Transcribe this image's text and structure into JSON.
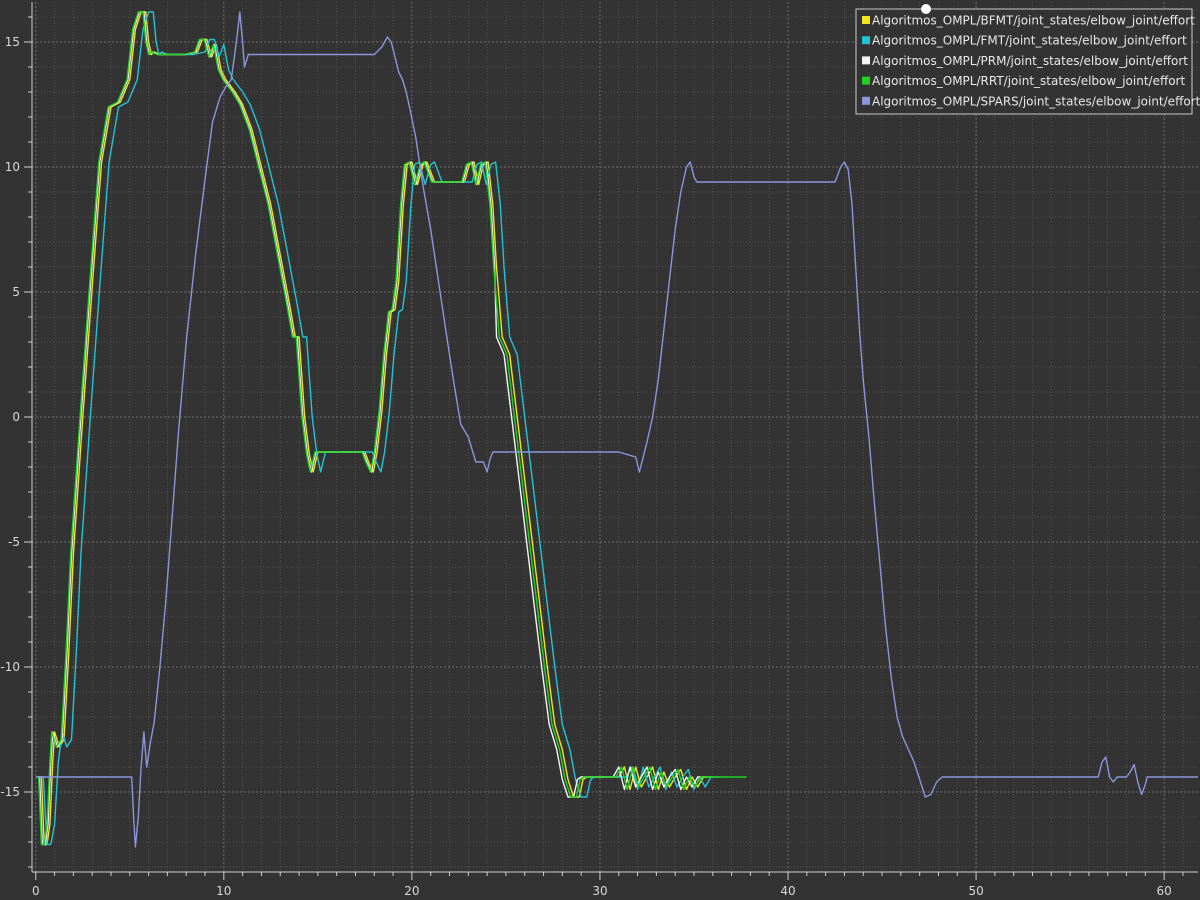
{
  "chart_data": {
    "type": "line",
    "title": "",
    "xlabel": "",
    "ylabel": "",
    "xlim": [
      -0.2,
      61.8
    ],
    "ylim": [
      -18.2,
      16.6
    ],
    "x_ticks": [
      0,
      10,
      20,
      30,
      40,
      50,
      60
    ],
    "x_tick_labels": [
      "0",
      "10",
      "20",
      "30",
      "40",
      "50",
      "60"
    ],
    "y_ticks": [
      -15,
      -10,
      -5,
      0,
      5,
      10,
      15
    ],
    "y_tick_labels": [
      "-15",
      "-10",
      "-5",
      "0",
      "5",
      "10",
      "15"
    ],
    "grid": true,
    "legend_position": "top-right",
    "background": "#333333",
    "series": [
      {
        "name": "Algoritmos_OMPL/BFMT/joint_states/elbow_joint/effort",
        "color": "#f2e41e",
        "x": [
          0.2,
          0.3,
          0.45,
          0.6,
          0.75,
          0.9,
          1.0,
          1.25,
          1.5,
          1.75,
          2.0,
          2.5,
          3.0,
          3.5,
          4.0,
          4.5,
          5.0,
          5.3,
          5.6,
          5.85,
          6.0,
          6.15,
          6.3,
          6.6,
          7.0,
          8.0,
          8.6,
          8.85,
          9.1,
          9.35,
          9.6,
          9.85,
          10.1,
          10.6,
          11.0,
          11.5,
          12.0,
          12.5,
          13.0,
          13.5,
          13.8,
          14.0,
          14.3,
          14.55,
          14.75,
          15.0,
          15.2,
          16.0,
          17.0,
          17.5,
          17.7,
          17.95,
          18.15,
          18.4,
          18.65,
          18.9,
          19.1,
          19.3,
          19.55,
          19.75,
          20.0,
          20.3,
          20.6,
          20.8,
          21.2,
          22.0,
          22.8,
          23.05,
          23.3,
          23.55,
          23.8,
          24.05,
          24.3,
          24.5,
          24.8,
          25.2,
          25.6,
          26.0,
          26.4,
          26.8,
          27.2,
          27.6,
          28.0,
          28.3,
          28.6,
          28.9,
          29.1,
          29.3,
          29.6,
          30.0,
          31.0,
          31.3,
          31.6,
          31.9,
          32.2,
          32.5,
          32.8,
          33.1,
          33.4,
          33.7,
          34.0,
          34.3,
          34.6,
          34.9,
          35.2,
          35.5,
          36.0
        ],
        "y": [
          -14.4,
          -14.4,
          -17.1,
          -17.1,
          -16.3,
          -13.8,
          -12.6,
          -13.2,
          -12.9,
          -9.5,
          -5.5,
          0.0,
          5.2,
          10.2,
          12.4,
          12.6,
          13.5,
          15.5,
          16.2,
          16.2,
          15.0,
          14.5,
          14.6,
          14.5,
          14.5,
          14.5,
          14.6,
          15.1,
          15.1,
          14.4,
          14.9,
          13.9,
          13.5,
          13.0,
          12.5,
          11.5,
          10.0,
          8.5,
          6.5,
          4.5,
          3.2,
          3.2,
          0.0,
          -1.5,
          -2.2,
          -1.4,
          -1.4,
          -1.4,
          -1.4,
          -1.4,
          -1.8,
          -2.2,
          -1.4,
          0.2,
          2.5,
          4.2,
          4.3,
          5.4,
          8.5,
          10.1,
          10.2,
          9.3,
          10.1,
          10.2,
          9.4,
          9.4,
          9.4,
          10.1,
          10.2,
          9.3,
          10.1,
          10.2,
          8.5,
          6.0,
          3.2,
          2.5,
          0.0,
          -2.5,
          -5.0,
          -7.5,
          -10.0,
          -12.3,
          -13.3,
          -14.5,
          -15.2,
          -15.2,
          -14.5,
          -14.4,
          -14.4,
          -14.4,
          -14.4,
          -14.0,
          -14.9,
          -14.0,
          -14.8,
          -14.4,
          -14.0,
          -14.9,
          -14.2,
          -14.8,
          -14.4,
          -14.1,
          -14.9,
          -14.4,
          -14.8,
          -14.4,
          -14.4
        ]
      },
      {
        "name": "Algoritmos_OMPL/FMT/joint_states/elbow_joint/effort",
        "color": "#22c4d4",
        "x": [
          0.25,
          0.4,
          0.6,
          0.8,
          1.0,
          1.2,
          1.4,
          1.65,
          1.9,
          2.15,
          2.4,
          2.9,
          3.4,
          3.9,
          4.4,
          4.9,
          5.4,
          5.7,
          6.0,
          6.25,
          6.4,
          6.55,
          6.7,
          7.0,
          7.4,
          8.4,
          9.0,
          9.25,
          9.5,
          9.75,
          10.0,
          10.25,
          10.5,
          11.0,
          11.4,
          11.9,
          12.4,
          12.9,
          13.4,
          13.9,
          14.2,
          14.4,
          14.7,
          14.95,
          15.15,
          15.4,
          15.6,
          16.4,
          17.4,
          17.9,
          18.1,
          18.35,
          18.55,
          18.8,
          19.05,
          19.3,
          19.5,
          19.7,
          19.95,
          20.15,
          20.4,
          20.7,
          21.0,
          21.2,
          21.6,
          22.4,
          23.2,
          23.45,
          23.7,
          23.95,
          24.2,
          24.45,
          24.7,
          24.9,
          25.2,
          25.6,
          26.0,
          26.4,
          26.8,
          27.2,
          27.6,
          28.0,
          28.4,
          28.7,
          29.0,
          29.3,
          29.5,
          29.7,
          30.0,
          30.4,
          31.4,
          31.7,
          32.0,
          32.3,
          32.6,
          32.9,
          33.2,
          33.5,
          33.8,
          34.1,
          34.4,
          34.7,
          35.0,
          35.3,
          35.6,
          35.9,
          36.4
        ],
        "y": [
          -14.4,
          -14.4,
          -17.1,
          -17.1,
          -16.3,
          -13.8,
          -12.6,
          -13.2,
          -12.9,
          -9.5,
          -5.5,
          0.0,
          5.2,
          10.2,
          12.4,
          12.6,
          13.5,
          15.5,
          16.2,
          16.2,
          15.0,
          14.5,
          14.6,
          14.5,
          14.5,
          14.5,
          14.6,
          15.1,
          15.1,
          14.4,
          14.9,
          13.9,
          13.5,
          13.0,
          12.5,
          11.5,
          10.0,
          8.5,
          6.5,
          4.5,
          3.2,
          3.2,
          0.0,
          -1.5,
          -2.2,
          -1.4,
          -1.4,
          -1.4,
          -1.4,
          -1.4,
          -1.8,
          -2.2,
          -1.4,
          0.2,
          2.5,
          4.2,
          4.3,
          5.4,
          8.5,
          10.1,
          10.2,
          9.3,
          10.1,
          10.2,
          9.4,
          9.4,
          9.4,
          10.1,
          10.2,
          9.3,
          10.1,
          10.2,
          8.5,
          6.0,
          3.2,
          2.5,
          0.0,
          -2.5,
          -5.0,
          -7.5,
          -10.0,
          -12.3,
          -13.3,
          -14.5,
          -15.2,
          -15.2,
          -14.5,
          -14.4,
          -14.4,
          -14.4,
          -14.4,
          -14.0,
          -14.9,
          -14.0,
          -14.8,
          -14.4,
          -14.0,
          -14.9,
          -14.2,
          -14.8,
          -14.4,
          -14.1,
          -14.9,
          -14.4,
          -14.8,
          -14.4,
          -14.4
        ]
      },
      {
        "name": "Algoritmos_OMPL/PRM/joint_states/elbow_joint/effort",
        "color": "#f4f4f4",
        "x": [
          0.1,
          0.2,
          0.35,
          0.5,
          0.65,
          0.8,
          0.9,
          1.15,
          1.4,
          1.65,
          1.9,
          2.4,
          2.9,
          3.4,
          3.9,
          4.4,
          4.9,
          5.2,
          5.5,
          5.75,
          5.9,
          6.05,
          6.2,
          6.5,
          6.9,
          7.9,
          8.5,
          8.75,
          9.0,
          9.25,
          9.5,
          9.75,
          10.0,
          10.5,
          10.9,
          11.4,
          11.9,
          12.4,
          12.9,
          13.4,
          13.7,
          13.9,
          14.2,
          14.45,
          14.65,
          14.9,
          15.1,
          15.9,
          16.9,
          17.4,
          17.6,
          17.85,
          18.05,
          18.3,
          18.55,
          18.8,
          19.0,
          19.2,
          19.45,
          19.65,
          19.9,
          20.2,
          20.5,
          20.7,
          21.1,
          21.9,
          22.7,
          22.95,
          23.2,
          23.45,
          23.7,
          23.95,
          24.2,
          24.4,
          24.5,
          24.9,
          25.3,
          25.7,
          26.1,
          26.5,
          26.9,
          27.3,
          27.7,
          28.0,
          28.3,
          28.6,
          28.8,
          29.0,
          29.3,
          29.7,
          30.7,
          31.0,
          31.3,
          31.6,
          31.9,
          32.2,
          32.5,
          32.8,
          33.1,
          33.4,
          33.7,
          34.0,
          34.3,
          34.6,
          34.9,
          35.2,
          35.7
        ],
        "y": [
          -14.4,
          -14.4,
          -17.1,
          -17.1,
          -16.3,
          -13.8,
          -12.6,
          -13.2,
          -12.9,
          -9.5,
          -5.5,
          0.0,
          5.2,
          10.2,
          12.4,
          12.6,
          13.5,
          15.5,
          16.2,
          16.2,
          15.0,
          14.5,
          14.6,
          14.5,
          14.5,
          14.5,
          14.6,
          15.1,
          15.1,
          14.4,
          14.9,
          13.9,
          13.5,
          13.0,
          12.5,
          11.5,
          10.0,
          8.5,
          6.5,
          4.5,
          3.2,
          3.2,
          0.0,
          -1.5,
          -2.2,
          -1.4,
          -1.4,
          -1.4,
          -1.4,
          -1.4,
          -1.8,
          -2.2,
          -1.4,
          0.2,
          2.5,
          4.2,
          4.3,
          5.4,
          8.5,
          10.1,
          10.2,
          9.3,
          10.1,
          10.2,
          9.4,
          9.4,
          9.4,
          10.1,
          10.2,
          9.3,
          10.1,
          10.2,
          8.5,
          6.0,
          3.2,
          2.5,
          0.0,
          -2.5,
          -5.0,
          -7.5,
          -10.0,
          -12.3,
          -13.3,
          -14.5,
          -15.2,
          -15.2,
          -14.5,
          -14.4,
          -14.4,
          -14.4,
          -14.4,
          -14.0,
          -14.9,
          -14.0,
          -14.8,
          -14.4,
          -14.0,
          -14.9,
          -14.2,
          -14.8,
          -14.4,
          -14.1,
          -14.9,
          -14.4,
          -14.8,
          -14.4,
          -14.4
        ]
      },
      {
        "name": "Algoritmos_OMPL/RRT/joint_states/elbow_joint/effort",
        "color": "#1ed21e",
        "x": [
          0.05,
          0.15,
          0.3,
          0.45,
          0.6,
          0.75,
          0.85,
          1.1,
          1.35,
          1.6,
          1.85,
          2.35,
          2.85,
          3.35,
          3.85,
          4.35,
          4.85,
          5.15,
          5.45,
          5.7,
          5.85,
          6.0,
          6.15,
          6.45,
          6.85,
          7.85,
          8.45,
          8.7,
          8.95,
          9.2,
          9.45,
          9.7,
          9.95,
          10.45,
          10.85,
          11.35,
          11.85,
          12.35,
          12.85,
          13.35,
          13.65,
          13.85,
          14.15,
          14.4,
          14.6,
          14.85,
          15.05,
          15.85,
          16.85,
          17.35,
          17.55,
          17.8,
          18.0,
          18.25,
          18.5,
          18.75,
          18.95,
          19.15,
          19.4,
          19.6,
          19.85,
          20.15,
          20.45,
          20.65,
          21.05,
          21.85,
          22.65,
          22.9,
          23.15,
          23.4,
          23.65,
          23.9,
          24.15,
          24.35,
          24.65,
          25.05,
          25.45,
          25.85,
          26.25,
          26.65,
          27.05,
          27.45,
          27.85,
          28.15,
          28.45,
          28.75,
          28.95,
          29.15,
          29.45,
          29.85,
          30.85,
          31.15,
          31.45,
          31.75,
          32.05,
          32.35,
          32.65,
          32.95,
          33.25,
          33.55,
          33.85,
          34.15,
          34.45,
          34.75,
          35.05,
          35.35,
          37.8
        ],
        "y": [
          -14.4,
          -14.4,
          -17.1,
          -17.1,
          -16.3,
          -13.8,
          -12.6,
          -13.2,
          -12.9,
          -9.5,
          -5.5,
          0.0,
          5.2,
          10.2,
          12.4,
          12.6,
          13.5,
          15.5,
          16.2,
          16.2,
          15.0,
          14.5,
          14.6,
          14.5,
          14.5,
          14.5,
          14.6,
          15.1,
          15.1,
          14.4,
          14.9,
          13.9,
          13.5,
          13.0,
          12.5,
          11.5,
          10.0,
          8.5,
          6.5,
          4.5,
          3.2,
          3.2,
          0.0,
          -1.5,
          -2.2,
          -1.4,
          -1.4,
          -1.4,
          -1.4,
          -1.4,
          -1.8,
          -2.2,
          -1.4,
          0.2,
          2.5,
          4.2,
          4.3,
          5.4,
          8.5,
          10.1,
          10.2,
          9.3,
          10.1,
          10.2,
          9.4,
          9.4,
          9.4,
          10.1,
          10.2,
          9.3,
          10.1,
          10.2,
          8.5,
          6.0,
          3.2,
          2.5,
          0.0,
          -2.5,
          -5.0,
          -7.5,
          -10.0,
          -12.3,
          -13.3,
          -14.5,
          -15.2,
          -15.2,
          -14.5,
          -14.4,
          -14.4,
          -14.4,
          -14.4,
          -14.0,
          -14.9,
          -14.0,
          -14.8,
          -14.4,
          -14.0,
          -14.9,
          -14.2,
          -14.8,
          -14.4,
          -14.1,
          -14.9,
          -14.4,
          -14.8,
          -14.4,
          -14.4
        ]
      },
      {
        "name": "Algoritmos_OMPL/SPARS/joint_states/elbow_joint/effort",
        "color": "#8c96dc",
        "x": [
          0.0,
          2.0,
          4.0,
          5.1,
          5.2,
          5.3,
          5.45,
          5.6,
          5.75,
          5.9,
          6.1,
          6.3,
          6.6,
          6.9,
          7.2,
          7.6,
          8.0,
          8.5,
          9.0,
          9.4,
          9.8,
          10.1,
          10.4,
          10.7,
          10.85,
          11.0,
          11.1,
          11.3,
          11.5,
          12.0,
          14.0,
          16.0,
          18.0,
          18.4,
          18.7,
          18.9,
          19.1,
          19.3,
          19.5,
          19.7,
          19.9,
          20.2,
          20.6,
          21.0,
          21.4,
          21.8,
          22.2,
          22.6,
          23.0,
          23.4,
          23.8,
          24.0,
          24.15,
          24.3,
          24.45,
          24.6,
          25.0,
          27.0,
          29.0,
          31.0,
          31.9,
          32.1,
          32.3,
          32.5,
          32.8,
          33.1,
          33.4,
          33.7,
          34.0,
          34.3,
          34.6,
          34.8,
          35.0,
          35.15,
          35.3,
          35.5,
          36.0,
          38.0,
          40.0,
          42.5,
          42.8,
          43.0,
          43.2,
          43.4,
          43.6,
          43.8,
          44.0,
          44.3,
          44.6,
          44.9,
          45.2,
          45.5,
          45.8,
          46.1,
          46.4,
          46.7,
          47.0,
          47.3,
          47.6,
          47.9,
          48.2,
          48.45,
          48.7,
          48.85,
          49.0,
          50.0,
          52.0,
          54.0,
          56.0,
          56.5,
          56.7,
          56.9,
          57.1,
          57.3,
          57.5,
          58.0,
          58.2,
          58.4,
          58.6,
          58.8,
          59.0,
          59.1,
          59.2,
          59.4,
          59.6,
          60.0,
          61.8
        ],
        "y": [
          -14.4,
          -14.4,
          -14.4,
          -14.4,
          -16.0,
          -17.2,
          -16.0,
          -14.0,
          -12.6,
          -14.0,
          -13.0,
          -12.2,
          -10.0,
          -7.5,
          -4.5,
          -0.5,
          3.0,
          6.5,
          9.5,
          11.8,
          12.8,
          13.2,
          13.5,
          15.2,
          16.2,
          15.0,
          14.0,
          14.5,
          14.5,
          14.5,
          14.5,
          14.5,
          14.5,
          14.8,
          15.2,
          15.0,
          14.4,
          13.8,
          13.5,
          13.0,
          12.3,
          11.2,
          9.2,
          7.5,
          5.5,
          3.5,
          1.5,
          -0.3,
          -0.8,
          -1.8,
          -1.8,
          -2.2,
          -1.7,
          -1.4,
          -1.4,
          -1.4,
          -1.4,
          -1.4,
          -1.4,
          -1.4,
          -1.6,
          -2.2,
          -1.6,
          -1.0,
          0.0,
          1.5,
          3.5,
          5.5,
          7.5,
          9.0,
          10.0,
          10.2,
          9.6,
          9.4,
          9.4,
          9.4,
          9.4,
          9.4,
          9.4,
          9.4,
          10.0,
          10.2,
          9.9,
          8.5,
          6.0,
          3.5,
          1.5,
          -0.8,
          -3.5,
          -6.0,
          -8.5,
          -10.5,
          -12.0,
          -12.8,
          -13.3,
          -13.8,
          -14.5,
          -15.2,
          -15.1,
          -14.6,
          -14.4,
          -14.4,
          -14.4,
          -14.4,
          -14.4,
          -14.4,
          -14.4,
          -14.4,
          -14.4,
          -14.4,
          -13.8,
          -13.6,
          -14.4,
          -14.6,
          -14.4,
          -14.4,
          -14.2,
          -13.9,
          -14.6,
          -15.1,
          -14.7,
          -14.4,
          -14.4,
          -14.4,
          -14.4,
          -14.4,
          -14.4
        ]
      }
    ]
  }
}
